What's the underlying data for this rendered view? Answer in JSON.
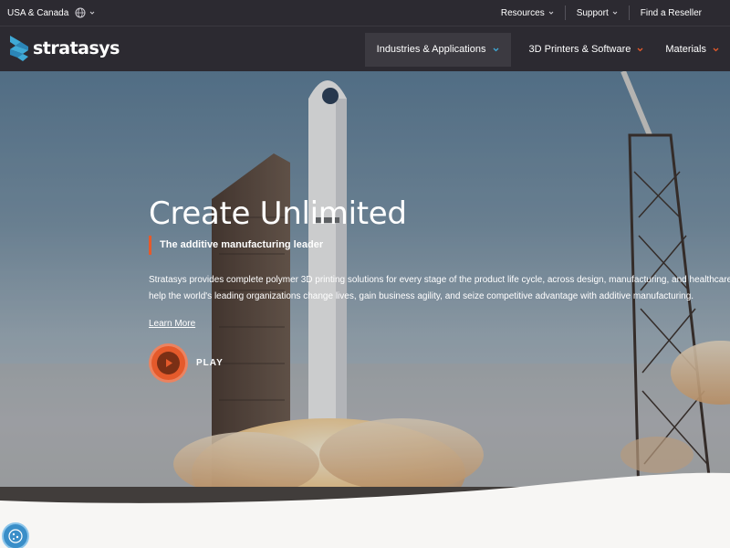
{
  "utility_bar": {
    "region": "USA & Canada",
    "links": [
      {
        "label": "Resources",
        "has_dropdown": true
      },
      {
        "label": "Support",
        "has_dropdown": true
      },
      {
        "label": "Find a Reseller",
        "has_dropdown": false
      }
    ]
  },
  "nav": {
    "logo_text": "stratasys",
    "items": [
      {
        "label": "Industries & Applications",
        "active": true,
        "caret_color": "#3fa9d6"
      },
      {
        "label": "3D Printers & Software",
        "active": false,
        "caret_color": "#e55a2b"
      },
      {
        "label": "Materials",
        "active": false,
        "caret_color": "#e55a2b"
      }
    ]
  },
  "hero": {
    "title": "Create Unlimited",
    "subtitle": "The additive manufacturing leader",
    "description_line1": "Stratasys provides complete polymer 3D printing solutions for every stage of the product life cycle, across design, manufacturing, and healthcare",
    "description_line2": "help the world's leading organizations change lives, gain business agility, and seize competitive advantage with additive manufacturing.",
    "learn_more": "Learn More",
    "play_label": "PLAY"
  },
  "colors": {
    "header_bg": "#2c2a31",
    "accent_orange": "#e55a2b",
    "accent_blue": "#3fa9d6"
  },
  "icons": [
    "globe-icon",
    "chevron-down-icon",
    "stratasys-logo-mark",
    "play-icon",
    "cookie-settings-icon"
  ]
}
